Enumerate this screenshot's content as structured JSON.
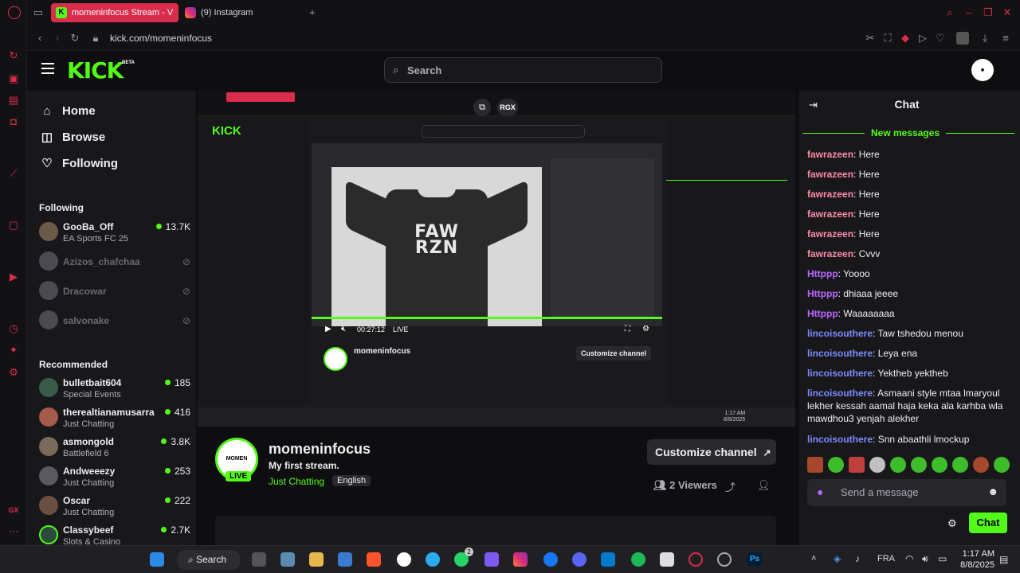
{
  "browser": {
    "tabs": [
      {
        "title": "momeninfocus Stream - V"
      },
      {
        "title": "(9) Instagram"
      }
    ],
    "url": "kick.com/momeninfocus"
  },
  "kick": {
    "logo": "KICK",
    "logo_badge": "BETA",
    "search_placeholder": "Search"
  },
  "sidebar": {
    "nav": [
      {
        "label": "Home",
        "icon": "home-icon"
      },
      {
        "label": "Browse",
        "icon": "compass-icon"
      },
      {
        "label": "Following",
        "icon": "heart-icon"
      }
    ],
    "following_title": "Following",
    "following": [
      {
        "name": "GooBa_Off",
        "category": "EA Sports FC 25",
        "viewers": "13.7K",
        "live": true
      },
      {
        "name": "Azizos_chafchaa",
        "live": false
      },
      {
        "name": "Dracowar",
        "live": false
      },
      {
        "name": "salvonake",
        "live": false
      }
    ],
    "recommended_title": "Recommended",
    "recommended": [
      {
        "name": "bulletbait604",
        "category": "Special Events",
        "viewers": "185"
      },
      {
        "name": "therealtianamusarra",
        "category": "Just Chatting",
        "viewers": "416"
      },
      {
        "name": "asmongold",
        "category": "Battlefield 6",
        "viewers": "3.8K"
      },
      {
        "name": "Andweeezy",
        "category": "Just Chatting",
        "viewers": "253"
      },
      {
        "name": "Oscar",
        "category": "Just Chatting",
        "viewers": "222"
      },
      {
        "name": "Classybeef",
        "category": "Slots & Casino",
        "viewers": "2.7K"
      }
    ]
  },
  "video": {
    "elapsed": "00:27:12",
    "live_label": "LIVE",
    "rgx_label": "RGX",
    "design_text": "FAW RZN"
  },
  "channel": {
    "name": "momeninfocus",
    "title": "My first stream.",
    "category": "Just Chatting",
    "language": "English",
    "live_badge": "LIVE",
    "customize_label": "Customize channel",
    "viewers": "2 Viewers"
  },
  "chat": {
    "title": "Chat",
    "new_messages": "New messages",
    "messages": [
      {
        "user": "fawrazeen",
        "text": "Here",
        "color": "#ff8ba7"
      },
      {
        "user": "fawrazeen",
        "text": "Here",
        "color": "#ff8ba7"
      },
      {
        "user": "fawrazeen",
        "text": "Here",
        "color": "#ff8ba7"
      },
      {
        "user": "fawrazeen",
        "text": "Here",
        "color": "#ff8ba7"
      },
      {
        "user": "fawrazeen",
        "text": "Here",
        "color": "#ff8ba7"
      },
      {
        "user": "fawrazeen",
        "text": "Cvvv",
        "color": "#ff8ba7"
      },
      {
        "user": "Httppp",
        "text": "Yoooo",
        "color": "#b967ff"
      },
      {
        "user": "Httppp",
        "text": "dhiaaa jeeee",
        "color": "#b967ff"
      },
      {
        "user": "Httppp",
        "text": "Waaaaaaaa",
        "color": "#b967ff"
      },
      {
        "user": "lincoisouthere",
        "text": "Taw tshedou menou",
        "color": "#7b8cff"
      },
      {
        "user": "lincoisouthere",
        "text": "Leya ena",
        "color": "#7b8cff"
      },
      {
        "user": "lincoisouthere",
        "text": "Yektheb yektheb",
        "color": "#7b8cff"
      },
      {
        "user": "lincoisouthere",
        "text": "Asmaani style mtaa lmaryoul lekher kessah aamal haja keka ala karhba wla mawdhou3 yenjah alekher",
        "color": "#7b8cff"
      },
      {
        "user": "lincoisouthere",
        "text": "Snn abaathli lmockup",
        "color": "#7b8cff"
      }
    ],
    "input_placeholder": "Send a message",
    "send_label": "Chat"
  },
  "taskbar": {
    "search_label": "Search",
    "language": "FRA",
    "time": "1:17 AM",
    "date": "8/8/2025",
    "whatsapp_badge": "2"
  },
  "colors": {
    "kick_green": "#53fc18",
    "opera_red": "#d92d4b",
    "background": "#0e0e10",
    "panel": "#18181b"
  }
}
